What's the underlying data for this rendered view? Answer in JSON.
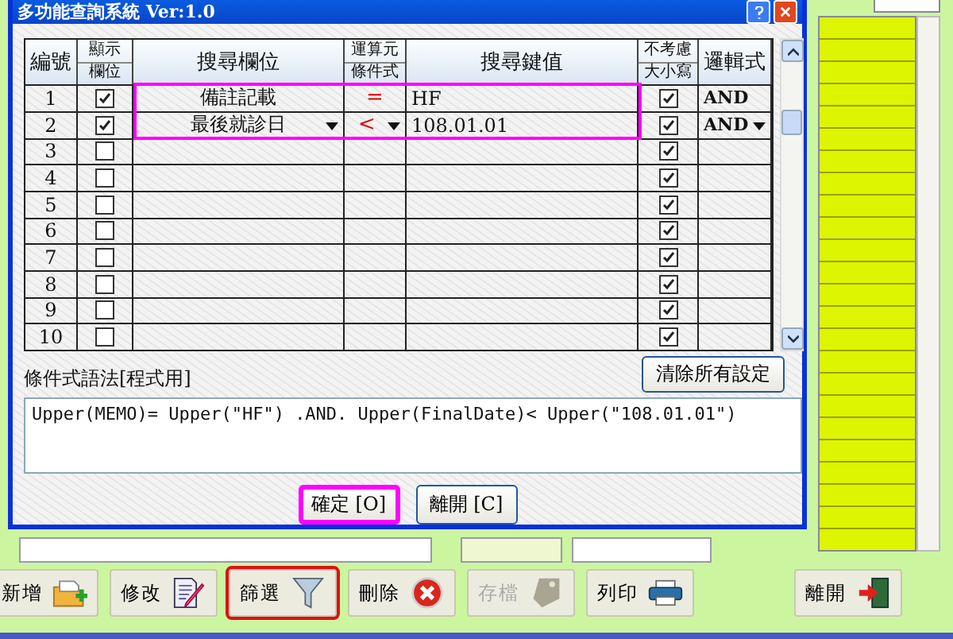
{
  "dialog": {
    "title": "多功能查詢系統 Ver:1.0",
    "columns": [
      {
        "lines": [
          "編號"
        ]
      },
      {
        "lines": [
          "顯示",
          "欄位"
        ]
      },
      {
        "lines": [
          "搜尋欄位"
        ]
      },
      {
        "lines": [
          "運算元",
          "條件式"
        ]
      },
      {
        "lines": [
          "搜尋鍵值"
        ]
      },
      {
        "lines": [
          "不考慮",
          "大小寫"
        ]
      },
      {
        "lines": [
          "邏輯式"
        ]
      }
    ],
    "rows": [
      {
        "number": "1",
        "show": true,
        "field": "備註記載",
        "field_dropdown": false,
        "operator": "=",
        "operator_dropdown": false,
        "value": "HF",
        "ignore_case": true,
        "logic": "AND",
        "logic_dropdown": false,
        "highlighted": true
      },
      {
        "number": "2",
        "show": true,
        "field": "最後就診日",
        "field_dropdown": true,
        "operator": "<",
        "operator_dropdown": true,
        "value": "108.01.01",
        "ignore_case": true,
        "logic": "AND",
        "logic_dropdown": true,
        "highlighted": true
      },
      {
        "number": "3",
        "show": false,
        "ignore_case": true,
        "highlighted": false
      },
      {
        "number": "4",
        "show": false,
        "ignore_case": true,
        "highlighted": false
      },
      {
        "number": "5",
        "show": false,
        "ignore_case": true,
        "highlighted": false
      },
      {
        "number": "6",
        "show": false,
        "ignore_case": true,
        "highlighted": false
      },
      {
        "number": "7",
        "show": false,
        "ignore_case": true,
        "highlighted": false
      },
      {
        "number": "8",
        "show": false,
        "ignore_case": true,
        "highlighted": false
      },
      {
        "number": "9",
        "show": false,
        "ignore_case": true,
        "highlighted": false
      },
      {
        "number": "10",
        "show": false,
        "ignore_case": true,
        "highlighted": false
      }
    ],
    "syntax_label": "條件式語法[程式用]",
    "clear_button": "清除所有設定",
    "syntax": "Upper(MEMO)= Upper(\"HF\") .AND. Upper(FinalDate)< Upper(\"108.01.01\")",
    "buttons": [
      {
        "label": "確定 [O]",
        "highlighted": true
      },
      {
        "label": "離開 [C]",
        "highlighted": false
      }
    ]
  },
  "toolbar": [
    {
      "label": "新增",
      "kind": "add",
      "disabled": false,
      "highlighted": false
    },
    {
      "label": "修改",
      "kind": "edit",
      "disabled": false,
      "highlighted": false
    },
    {
      "label": "篩選",
      "kind": "filter",
      "disabled": false,
      "highlighted": true
    },
    {
      "label": "刪除",
      "kind": "delete",
      "disabled": false,
      "highlighted": false
    },
    {
      "label": "存檔",
      "kind": "save",
      "disabled": true,
      "highlighted": false
    },
    {
      "label": "列印",
      "kind": "print",
      "disabled": false,
      "highlighted": false
    },
    {
      "label": "離開",
      "kind": "exit",
      "disabled": false,
      "highlighted": false
    }
  ]
}
